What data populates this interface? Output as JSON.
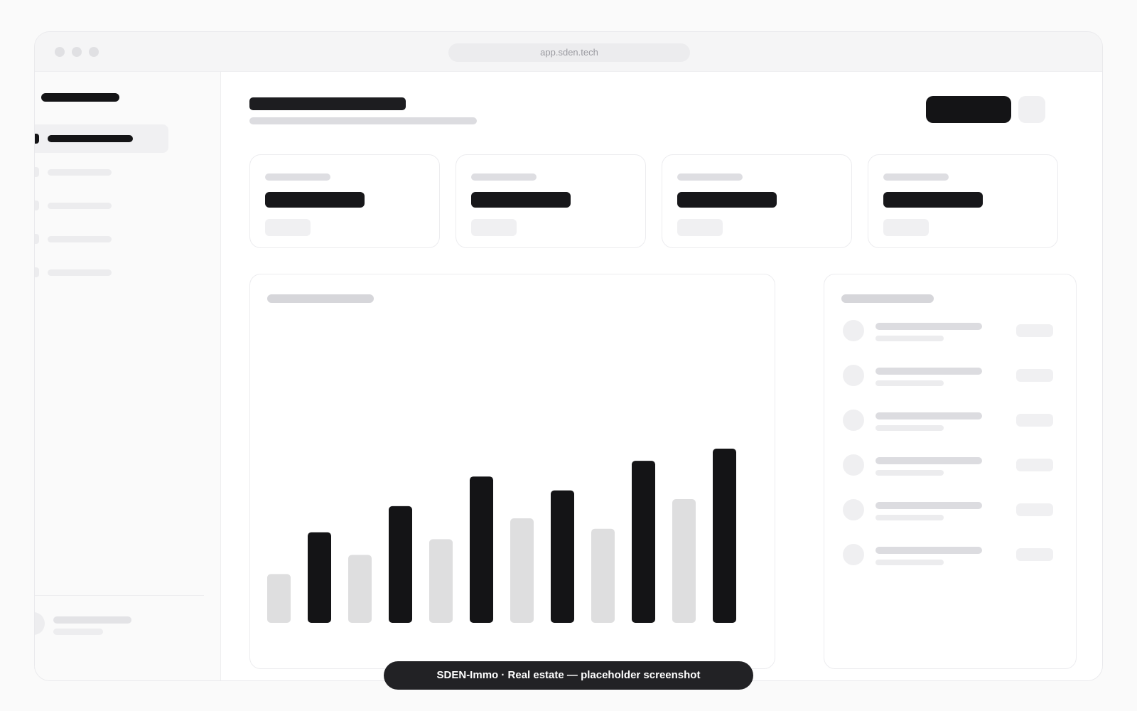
{
  "browser": {
    "url": "app.sden.tech"
  },
  "caption": "SDEN-Immo · Real estate — placeholder screenshot",
  "colors": {
    "accent": "#141416",
    "bar_dark": "#141416",
    "bar_light": "#dededf",
    "skeleton": "#ececee"
  },
  "chart_data": {
    "type": "bar",
    "values": [
      28,
      52,
      39,
      67,
      48,
      84,
      60,
      76,
      54,
      93,
      71,
      100
    ],
    "ylim": [
      0,
      100
    ],
    "grid": false
  },
  "icons": {
    "window_controls": [
      "window-dot-icon",
      "window-dot-icon",
      "window-dot-icon"
    ],
    "logo": "logo-mark-icon"
  }
}
